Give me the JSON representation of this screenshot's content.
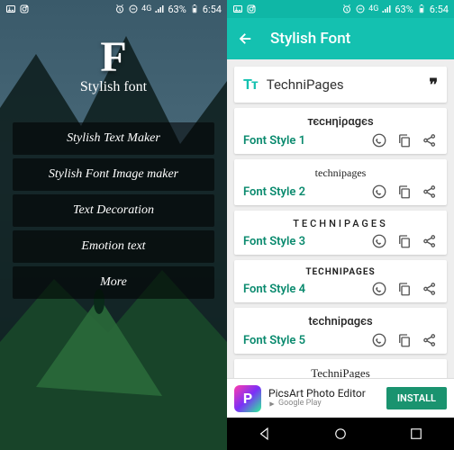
{
  "status": {
    "time": "6:54",
    "battery": "63%",
    "network": "4G"
  },
  "left": {
    "logo_letter": "F",
    "logo_subtitle": "Stylish font",
    "menu": [
      "Stylish Text Maker",
      "Stylish Font Image maker",
      "Text Decoration",
      "Emotion text",
      "More"
    ]
  },
  "right": {
    "app_title": "Stylish Font",
    "input_icon": "Tᴛ",
    "input_value": "TechniPages",
    "styles": [
      {
        "preview": "тєcнηіραgєѕ",
        "label": "Font Style 1",
        "preview_class": ""
      },
      {
        "preview": "technipages",
        "label": "Font Style 2",
        "preview_class": "sp-serif"
      },
      {
        "preview": "TECHNIPAGES",
        "label": "Font Style 3",
        "preview_class": "sp3"
      },
      {
        "preview": "TECHNIPAGES",
        "label": "Font Style 4",
        "preview_class": "sp-small"
      },
      {
        "preview": "tєchnipαgєs",
        "label": "Font Style 5",
        "preview_class": ""
      }
    ],
    "cut_preview": "TechniPages",
    "ad": {
      "title": "PicsArt Photo Editor",
      "subtitle": "Google Play",
      "cta": "INSTALL",
      "icon_letter": "P"
    }
  }
}
